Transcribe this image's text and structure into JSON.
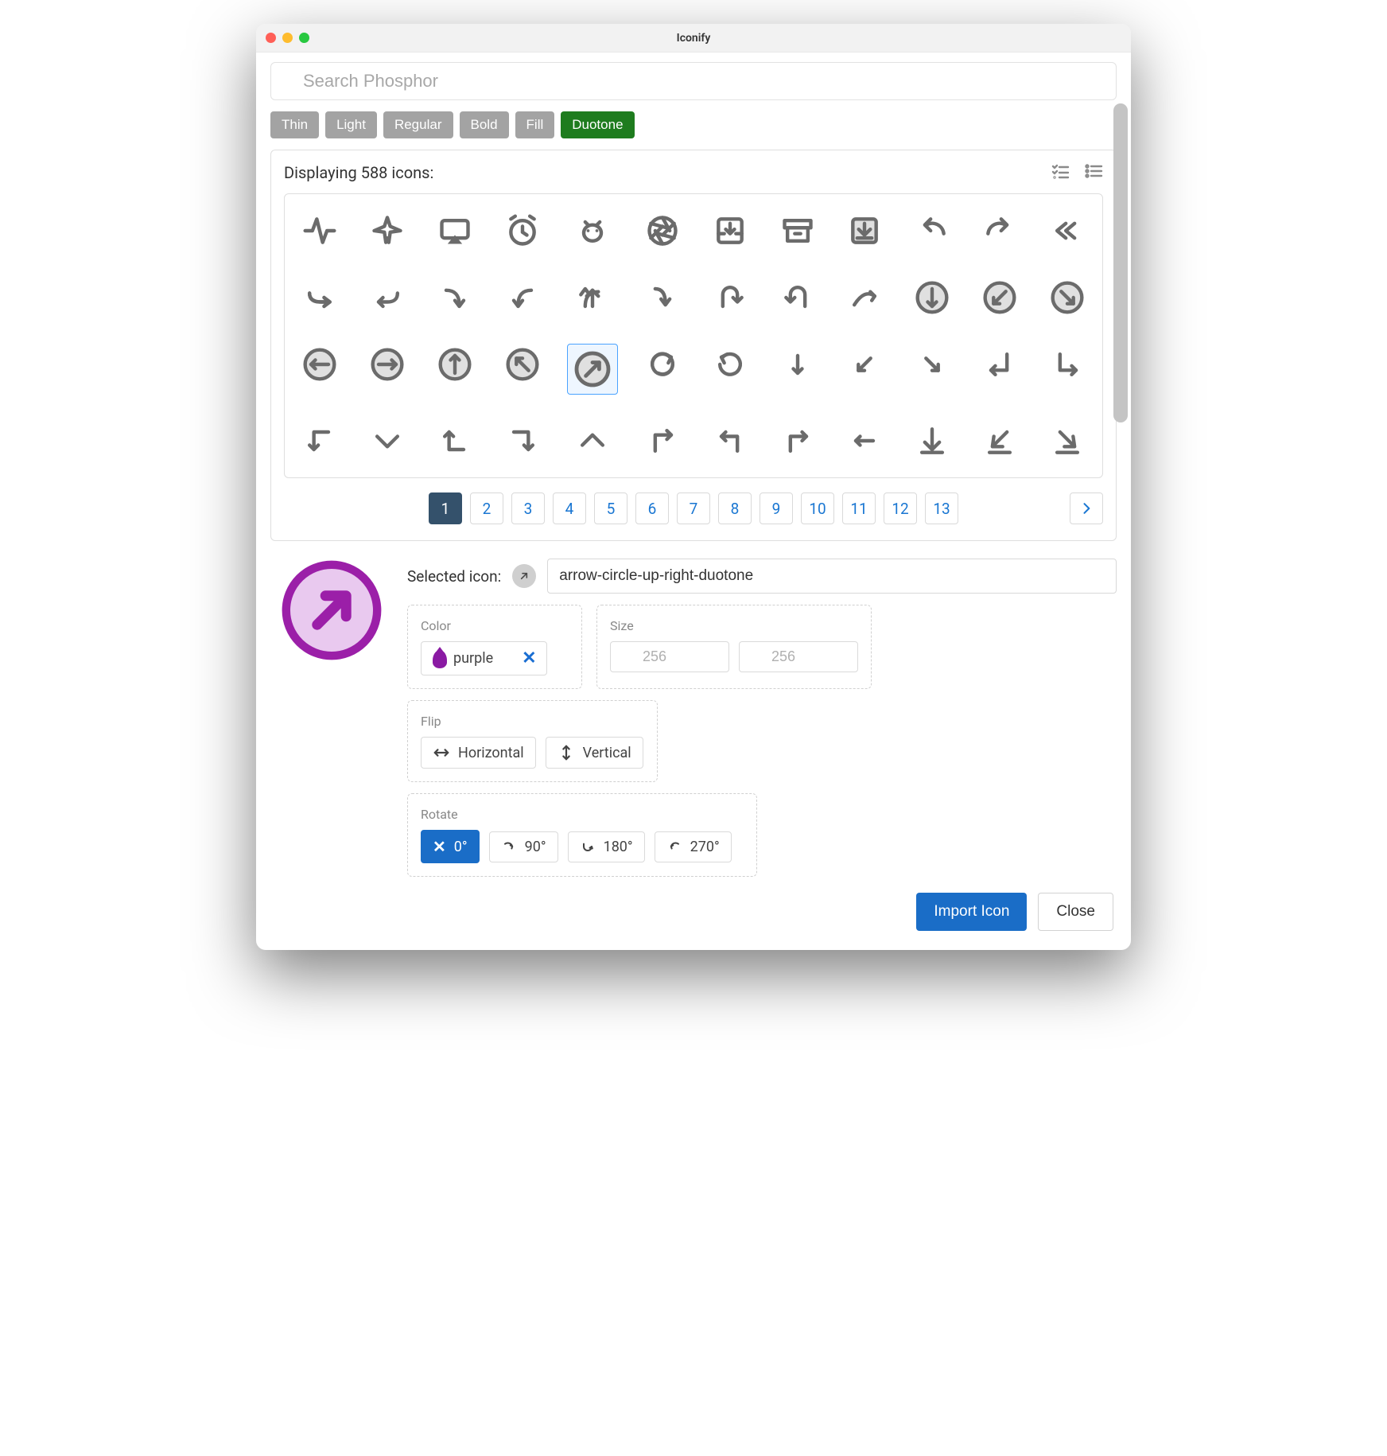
{
  "window": {
    "title": "Iconify"
  },
  "search": {
    "placeholder": "Search Phosphor"
  },
  "filters": [
    {
      "label": "Thin",
      "active": false
    },
    {
      "label": "Light",
      "active": false
    },
    {
      "label": "Regular",
      "active": false
    },
    {
      "label": "Bold",
      "active": false
    },
    {
      "label": "Fill",
      "active": false
    },
    {
      "label": "Duotone",
      "active": true
    }
  ],
  "results": {
    "count_text": "Displaying 588 icons:",
    "icons": [
      "activity",
      "airplane",
      "airplay",
      "alarm",
      "android-logo",
      "aperture",
      "archive-tray",
      "archive",
      "download-tray",
      "undo",
      "redo",
      "reply-all",
      "bend-right",
      "bend-left",
      "bend-down-right",
      "bend-down-left",
      "bend-up",
      "bend-down",
      "u-turn-right",
      "u-turn-left",
      "curve-right",
      "circle-down",
      "circle-down-left",
      "circle-down-right",
      "circle-left",
      "circle-right",
      "circle-up",
      "circle-up-left",
      "circle-up-right",
      "rotate-cw",
      "rotate-ccw",
      "arrow-down",
      "arrow-down-left",
      "arrow-down-right",
      "elbow-down-left",
      "elbow-down-right",
      "elbow-left-down",
      "elbow-down",
      "elbow-left-up",
      "elbow-right-down",
      "elbow-up",
      "elbow-up-right",
      "corner-up-left",
      "corner-up-right",
      "arrow-left",
      "line-down",
      "line-down-left",
      "line-down-right"
    ],
    "selected_index": 28,
    "pager": {
      "pages": [
        "1",
        "2",
        "3",
        "4",
        "5",
        "6",
        "7",
        "8",
        "9",
        "10",
        "11",
        "12",
        "13"
      ],
      "active": 0
    }
  },
  "selected": {
    "label": "Selected icon:",
    "name": "arrow-circle-up-right-duotone",
    "preview_color": "#9b1fa8",
    "preview_fill": "#e9c9ef"
  },
  "options": {
    "color": {
      "label": "Color",
      "value": "purple"
    },
    "size": {
      "label": "Size",
      "width_placeholder": "256",
      "height_placeholder": "256"
    },
    "flip": {
      "label": "Flip",
      "h": "Horizontal",
      "v": "Vertical"
    },
    "rotate": {
      "label": "Rotate",
      "values": [
        "0°",
        "90°",
        "180°",
        "270°"
      ],
      "active": 0
    }
  },
  "footer": {
    "import": "Import Icon",
    "close": "Close"
  }
}
